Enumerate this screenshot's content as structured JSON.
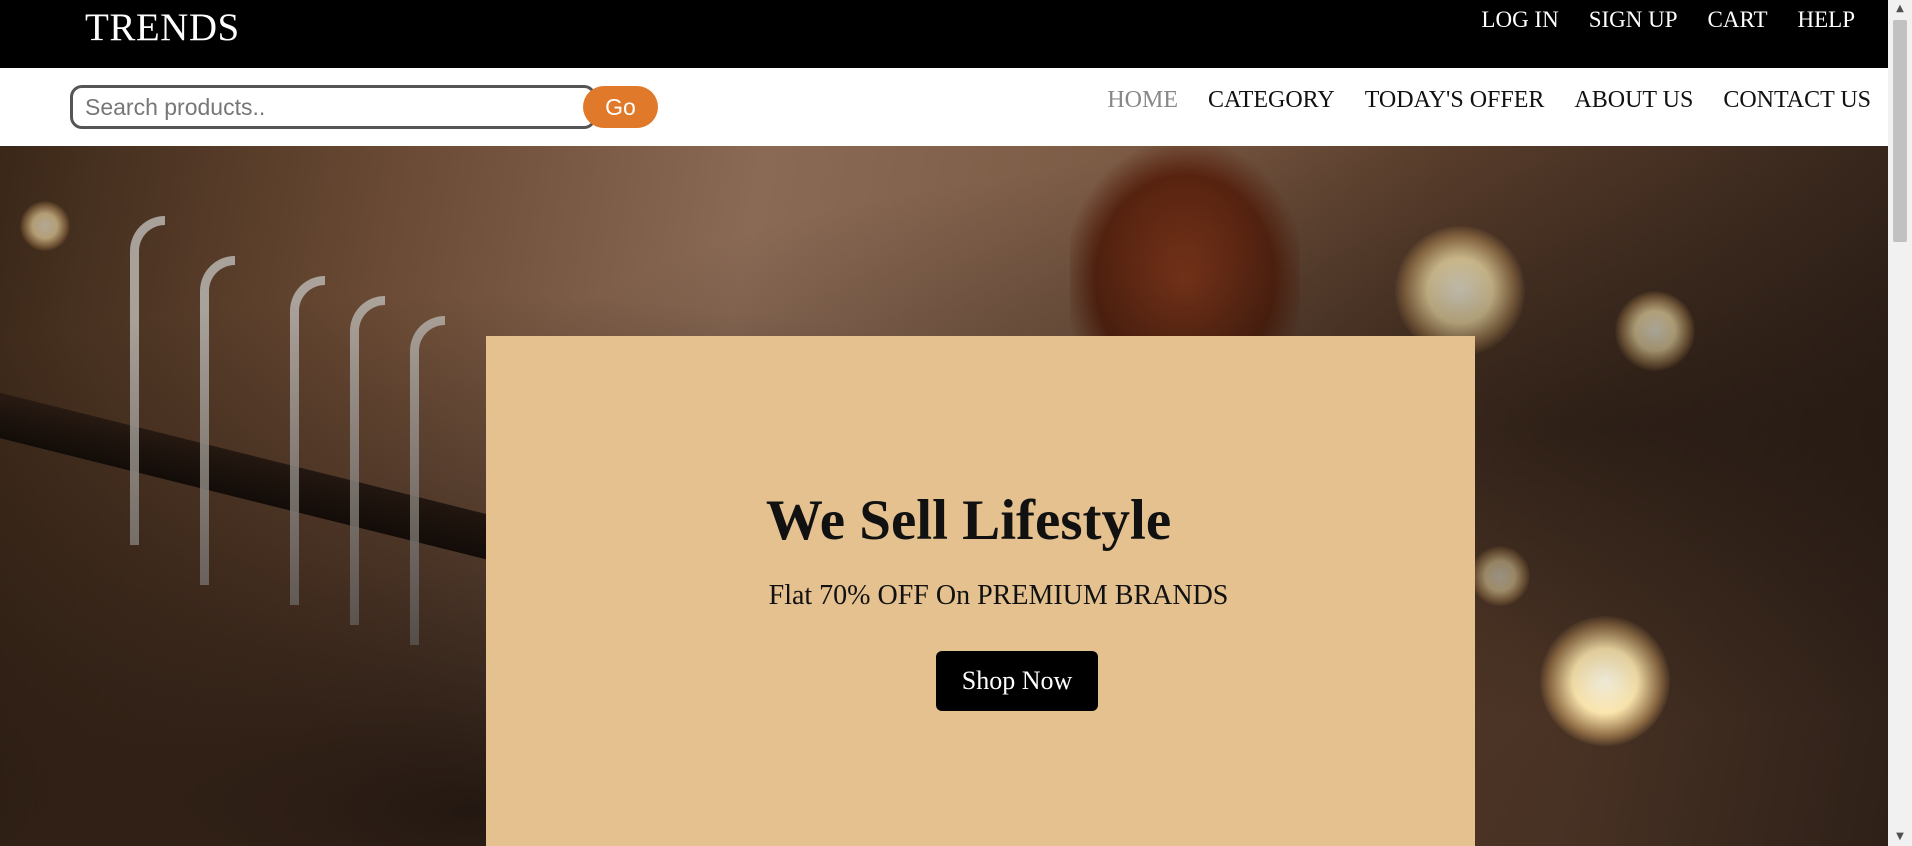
{
  "header": {
    "brand": "TRENDS",
    "links": [
      "LOG IN",
      "SIGN UP",
      "CART",
      "HELP"
    ]
  },
  "search": {
    "placeholder": "Search products..",
    "value": "",
    "button_label": "Go"
  },
  "nav": {
    "items": [
      "HOME",
      "CATEGORY",
      "TODAY'S OFFER",
      "ABOUT US",
      "CONTACT US"
    ],
    "active": "HOME"
  },
  "hero": {
    "title": "We Sell Lifestyle",
    "subtitle": "Flat 70% OFF On PREMIUM BRANDS",
    "cta_label": "Shop Now"
  },
  "colors": {
    "topbar": "#000000",
    "accent": "#e07a2a",
    "promo_panel": "#e4c18f",
    "nav_active": "#888888"
  },
  "icons": {
    "scroll_up": "chevron-up-icon",
    "scroll_down": "chevron-down-icon"
  }
}
